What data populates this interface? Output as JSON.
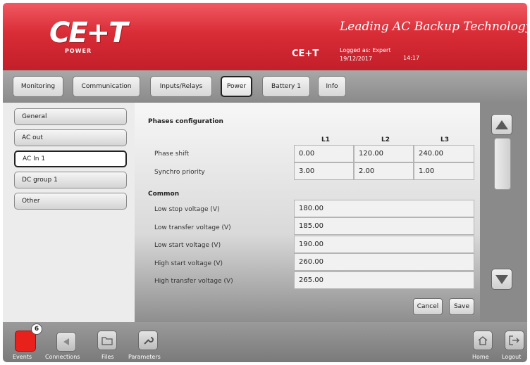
{
  "header": {
    "logo_text": "CE+T",
    "logo_sub": "POWER",
    "tagline": "Leading AC Backup Technology",
    "brand": "CE+T",
    "logged_as": "Logged as: Expert",
    "date": "19/12/2017",
    "time": "14:17"
  },
  "tabs": [
    {
      "label": "Monitoring"
    },
    {
      "label": "Communication"
    },
    {
      "label": "Inputs/Relays"
    },
    {
      "label": "Power"
    },
    {
      "label": "Battery 1"
    },
    {
      "label": "Info"
    }
  ],
  "active_tab": "Power",
  "menu": [
    {
      "label": "General"
    },
    {
      "label": "AC out"
    },
    {
      "label": "AC In 1"
    },
    {
      "label": "DC group 1"
    },
    {
      "label": "Other"
    }
  ],
  "active_menu": "AC In 1",
  "phases": {
    "title": "Phases configuration",
    "columns": [
      "L1",
      "L2",
      "L3"
    ],
    "rows": [
      {
        "label": "Phase shift",
        "values": [
          "0.00",
          "120.00",
          "240.00"
        ]
      },
      {
        "label": "Synchro priority",
        "values": [
          "3.00",
          "2.00",
          "1.00"
        ]
      }
    ]
  },
  "common": {
    "title": "Common",
    "rows": [
      {
        "label": "Low stop voltage (V)",
        "value": "180.00"
      },
      {
        "label": "Low transfer voltage (V)",
        "value": "185.00"
      },
      {
        "label": "Low start voltage (V)",
        "value": "190.00"
      },
      {
        "label": "High start voltage (V)",
        "value": "260.00"
      },
      {
        "label": "High transfer voltage (V)",
        "value": "265.00"
      }
    ]
  },
  "buttons": {
    "cancel": "Cancel",
    "save": "Save"
  },
  "bottom": {
    "events": "Events",
    "events_count": "6",
    "connections": "Connections",
    "files": "Files",
    "parameters": "Parameters",
    "home": "Home",
    "logout": "Logout"
  },
  "colors": {
    "header_red": "#d92c36",
    "events_red": "#e8211c"
  }
}
